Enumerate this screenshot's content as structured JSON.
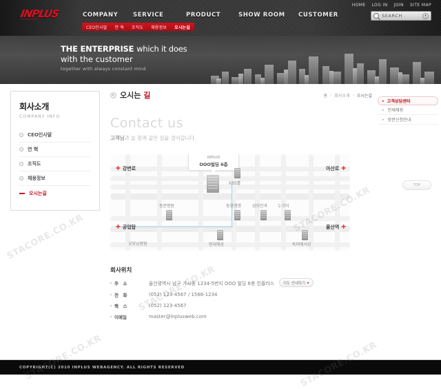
{
  "header": {
    "logo_text": "INPLUS",
    "logo_sub": "WEBAGENCY",
    "utility": [
      "HOME",
      "LOG IN",
      "JOIN",
      "SITE MAP"
    ],
    "search_placeholder": "SEARCH",
    "search_icon": "search-icon",
    "dropdown_icon": "chevron-down-icon",
    "gnb": [
      "COMPANY",
      "SERVICE",
      "PRODUCT",
      "SHOW ROOM",
      "CUSTOMER"
    ],
    "subnav": [
      "CEO인사말",
      "연 혁",
      "조직도",
      "채용정보",
      "오시는길"
    ],
    "subnav_active": "오시는길"
  },
  "hero": {
    "line1_strong": "THE ENTERPRISE ",
    "line1_rest": "which it does",
    "line2": "with the customer",
    "line3": "together with always constant mind"
  },
  "sidebar": {
    "title": "회사소개",
    "subtitle": "COMPANY INFO",
    "items": [
      {
        "label": "CEO인사말",
        "active": false
      },
      {
        "label": "연 혁",
        "active": false
      },
      {
        "label": "조직도",
        "active": false
      },
      {
        "label": "채용정보",
        "active": false
      },
      {
        "label": "오시는길",
        "active": true
      }
    ]
  },
  "page": {
    "title": "오시는 ",
    "title_accent": "길",
    "breadcrumb": [
      "홈",
      "회사소개",
      "오시는길"
    ],
    "contact_heading": "Contact us",
    "contact_sub_strong": "고객님",
    "contact_sub_rest": "과 늘 함께 같은 길을 걸어갑니다."
  },
  "map": {
    "callout_logo": "INPLUS",
    "callout_text": "OOO빌딩 6층",
    "roads": [
      {
        "name": "강변로",
        "pos": "left-top"
      },
      {
        "name": "아산로",
        "pos": "right-top"
      },
      {
        "name": "공업탑",
        "pos": "left-bottom"
      },
      {
        "name": "울산역",
        "pos": "right-bottom"
      }
    ],
    "landmarks": [
      "KBS홀",
      "동문병원",
      "동양생명",
      "성모안과",
      "누크어",
      "굿모닝병원",
      "현대해상",
      "똑띠에식당"
    ]
  },
  "info": {
    "heading": "회사위치",
    "rows": [
      {
        "key": "주　소",
        "value": "울산광역시 남구 가사동 1234-5번지 OOO 빌딩 6층 인플러스",
        "button": "지도 안내하기"
      },
      {
        "key": "전　화",
        "value": "(052) 123-4567 / 1566-1234",
        "button": ""
      },
      {
        "key": "팩　스",
        "value": "(052) 123-4567",
        "button": ""
      },
      {
        "key": "이메일",
        "value": "master@lnplusweb.com",
        "button": ""
      }
    ]
  },
  "quick": {
    "main": "고객상담센터",
    "items": [
      "인재채용",
      "방문신청안내"
    ],
    "tag": "TOP"
  },
  "footer": {
    "copyright": "COPYRIGHT(C) 2010 INPLUS WEBAGENCY. ALL RIGHTS RESERVED"
  },
  "watermark": "STACORE.CO.KR",
  "colors": {
    "accent": "#c2101c",
    "dark": "#2b2b2b",
    "route": "#9fd0e8"
  }
}
